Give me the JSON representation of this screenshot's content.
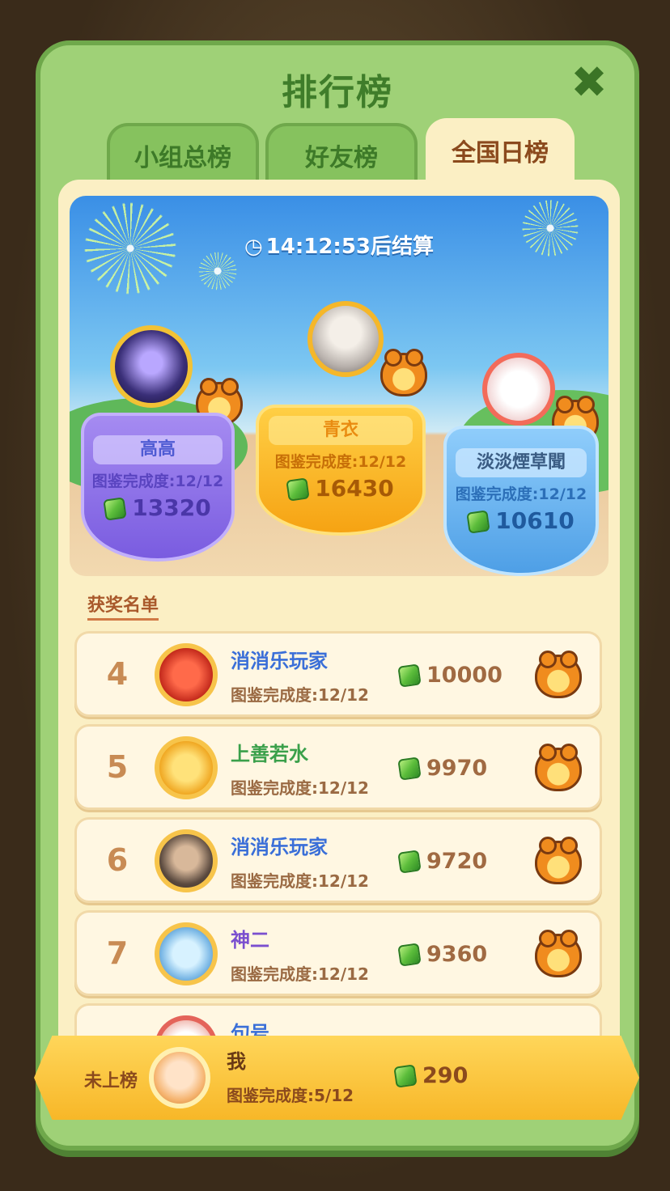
{
  "title": "排行榜",
  "tabs": [
    {
      "label": "小组总榜"
    },
    {
      "label": "好友榜"
    },
    {
      "label": "全国日榜"
    }
  ],
  "timer": {
    "text": "14:12:53后结算"
  },
  "top3": [
    {
      "rank": 1,
      "name": "青衣",
      "progress": "图鉴完成度:12/12",
      "score": "16430"
    },
    {
      "rank": 2,
      "name": "高高",
      "progress": "图鉴完成度:12/12",
      "score": "13320"
    },
    {
      "rank": 3,
      "name": "淡淡煙草聞",
      "progress": "图鉴完成度:12/12",
      "score": "10610"
    }
  ],
  "awards_title": "获奖名单",
  "rows": [
    {
      "rank": "4",
      "name": "消消乐玩家",
      "progress": "图鉴完成度:12/12",
      "score": "10000",
      "name_color": "#3a6fd8"
    },
    {
      "rank": "5",
      "name": "上善若水",
      "progress": "图鉴完成度:12/12",
      "score": "9970",
      "name_color": "#3aa04a"
    },
    {
      "rank": "6",
      "name": "消消乐玩家",
      "progress": "图鉴完成度:12/12",
      "score": "9720",
      "name_color": "#3a6fd8"
    },
    {
      "rank": "7",
      "name": "神二",
      "progress": "图鉴完成度:12/12",
      "score": "9360",
      "name_color": "#7a4fcf"
    },
    {
      "rank": "",
      "name": "句号",
      "progress": "",
      "score": "",
      "name_color": "#3a6fd8"
    }
  ],
  "me": {
    "status": "未上榜",
    "name": "我",
    "progress": "图鉴完成度:5/12",
    "score": "290"
  },
  "colors": {
    "panel": "#9fd177",
    "content": "#fbefc4",
    "gold": "#f6a313",
    "purple": "#7a5ce0",
    "blue": "#4e9fe6"
  },
  "icons": {
    "close": "close-icon",
    "clock": "clock-icon",
    "gem": "gem-icon",
    "tiger": "tiger-badge-icon"
  }
}
